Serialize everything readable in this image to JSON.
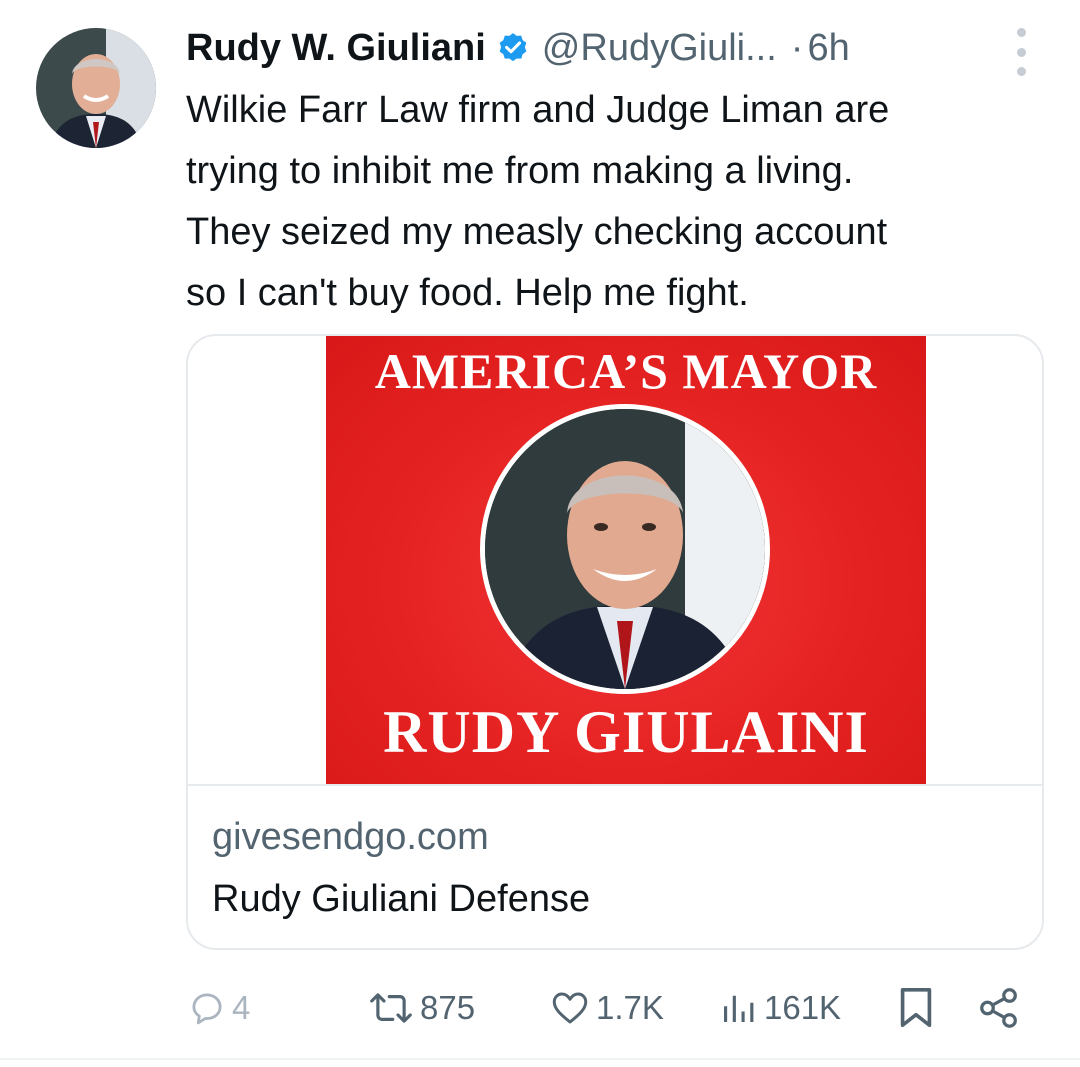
{
  "author": {
    "display_name": "Rudy W. Giuliani",
    "handle": "@RudyGiuli...",
    "separator": "·",
    "timestamp": "6h",
    "verified": true
  },
  "tweet": {
    "text": "Wilkie Farr Law firm and Judge Liman are\ntrying to inhibit me from making a living.\nThey seized my measly checking account\nso I can't buy food. Help me fight."
  },
  "card": {
    "image": {
      "top_text": "AMERICA’S MAYOR",
      "bottom_text": "RUDY GIULAINI"
    },
    "domain": "givesendgo.com",
    "title": "Rudy Giuliani Defense"
  },
  "actions": {
    "replies": "4",
    "reposts": "875",
    "likes": "1.7K",
    "views": "161K"
  },
  "icons": {
    "verified": "verified-badge-icon",
    "more": "more-vertical-icon",
    "reply": "reply-icon",
    "retweet": "retweet-icon",
    "like": "heart-icon",
    "views": "views-chart-icon",
    "bookmark": "bookmark-icon",
    "share": "share-icon"
  },
  "colors": {
    "text": "#0f1419",
    "secondary": "#536471",
    "verified_blue": "#1d9bf0",
    "card_red": "#e52222",
    "border": "#e7eaed"
  }
}
